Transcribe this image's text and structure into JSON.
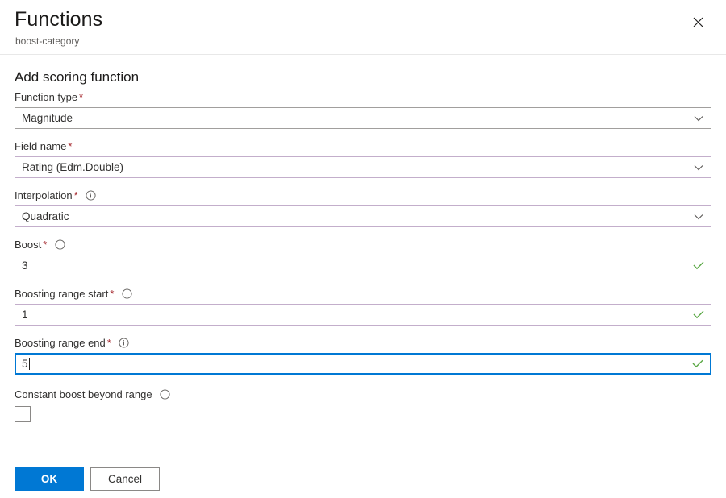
{
  "header": {
    "title": "Functions",
    "subtitle": "boost-category",
    "close_icon": "close-icon"
  },
  "section": {
    "heading": "Add scoring function"
  },
  "colors": {
    "primary": "#0078d4",
    "required_asterisk": "#a4262c",
    "valid_check": "#5ba845",
    "field_border": "#c3aecb",
    "field_border_neutral": "#a19f9d",
    "focus_border": "#0078d4",
    "text": "#323130",
    "subtle_text": "#605e5c"
  },
  "fields": [
    {
      "label": "Function type",
      "required": true,
      "required_mark": "*",
      "has_info": false,
      "value": "Magnitude",
      "control": "dropdown",
      "adornment": "chevron-down-icon",
      "border": "neutral",
      "focused": false
    },
    {
      "label": "Field name",
      "required": true,
      "required_mark": "*",
      "has_info": false,
      "value": "Rating (Edm.Double)",
      "control": "dropdown",
      "adornment": "chevron-down-icon",
      "border": "valid",
      "focused": false
    },
    {
      "label": "Interpolation",
      "required": true,
      "required_mark": "*",
      "has_info": true,
      "value": "Quadratic",
      "control": "dropdown",
      "adornment": "chevron-down-icon",
      "border": "valid",
      "focused": false
    },
    {
      "label": "Boost",
      "required": true,
      "required_mark": "*",
      "has_info": true,
      "value": "3",
      "control": "textbox",
      "adornment": "check-icon",
      "border": "valid",
      "focused": false
    },
    {
      "label": "Boosting range start",
      "required": true,
      "required_mark": "*",
      "has_info": true,
      "value": "1",
      "control": "textbox",
      "adornment": "check-icon",
      "border": "valid",
      "focused": false
    },
    {
      "label": "Boosting range end",
      "required": true,
      "required_mark": "*",
      "has_info": true,
      "value": "5",
      "control": "textbox",
      "adornment": "check-icon",
      "border": "focus",
      "focused": true
    }
  ],
  "checkbox": {
    "label": "Constant boost beyond range",
    "has_info": true,
    "checked": false
  },
  "buttons": {
    "ok": "OK",
    "cancel": "Cancel"
  }
}
